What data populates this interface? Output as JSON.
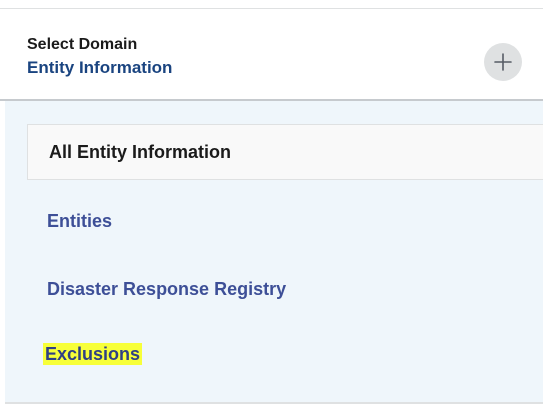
{
  "domain_header": {
    "kicker": "Select Domain",
    "selected_domain": "Entity Information",
    "add_icon": "plus-icon"
  },
  "menu": {
    "active_item": "All Entity Information",
    "items": [
      {
        "label": "Entities",
        "highlighted": false
      },
      {
        "label": "Disaster Response Registry",
        "highlighted": false
      },
      {
        "label": "Exclusions",
        "highlighted": true
      }
    ],
    "colors": {
      "link": "#3d4f97",
      "selected_domain": "#1a4480",
      "highlight": "#f7ff39",
      "panel_background": "#eff6fb"
    }
  }
}
